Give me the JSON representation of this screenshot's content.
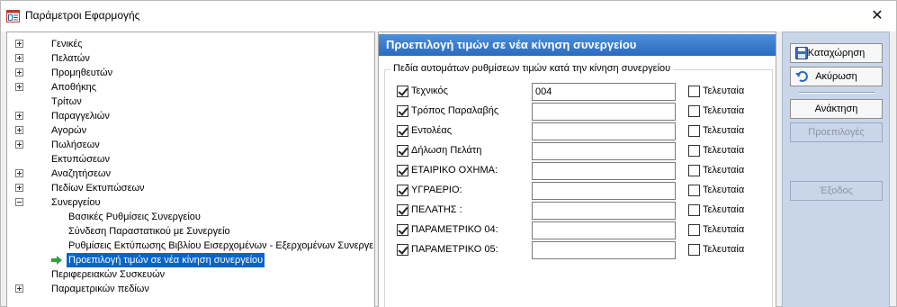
{
  "window": {
    "title": "Παράμετροι Εφαρμογής",
    "close_symbol": "✕"
  },
  "tree": {
    "items": [
      {
        "label": "Γενικές",
        "toggle": "plus"
      },
      {
        "label": "Πελατών",
        "toggle": "plus"
      },
      {
        "label": "Προμηθευτών",
        "toggle": "plus"
      },
      {
        "label": "Αποθήκης",
        "toggle": "plus"
      },
      {
        "label": "Τρίτων",
        "toggle": "none"
      },
      {
        "label": "Παραγγελιών",
        "toggle": "plus"
      },
      {
        "label": "Αγορών",
        "toggle": "plus"
      },
      {
        "label": "Πωλήσεων",
        "toggle": "plus"
      },
      {
        "label": "Εκτυπώσεων",
        "toggle": "none"
      },
      {
        "label": "Αναζητήσεων",
        "toggle": "plus"
      },
      {
        "label": "Πεδίων Εκτυπώσεων",
        "toggle": "plus"
      },
      {
        "label": "Συνεργείου",
        "toggle": "minus"
      },
      {
        "label": "Βασικές Ρυθμίσεις Συνεργείου",
        "toggle": "child"
      },
      {
        "label": "Σύνδεση Παραστατικού με Συνεργείο",
        "toggle": "child"
      },
      {
        "label": "Ρυθμίσεις Εκτύπωσης Βιβλίου Εισερχομένων - Εξερχομένων Συνεργείου",
        "toggle": "child"
      },
      {
        "label": "Προεπιλογή τιμών σε νέα κίνηση συνεργείου",
        "toggle": "selected"
      },
      {
        "label": "Περιφερειακών Συσκευών",
        "toggle": "none"
      },
      {
        "label": "Παραμετρικών πεδίων",
        "toggle": "plus"
      }
    ]
  },
  "content": {
    "header": "Προεπιλογή τιμών σε νέα κίνηση συνεργείου",
    "group_title": "Πεδία αυτομάτων ρυθμίσεων τιμών κατά την κίνηση συνεργείου",
    "last_label": "Τελευταία",
    "fields": [
      {
        "label": "Τεχνικός",
        "checked": true,
        "value": "004",
        "last_checked": false
      },
      {
        "label": "Τρόπος Παραλαβής",
        "checked": true,
        "value": "",
        "last_checked": false
      },
      {
        "label": "Εντολέας",
        "checked": true,
        "value": "",
        "last_checked": false
      },
      {
        "label": "Δήλωση Πελάτη",
        "checked": true,
        "value": "",
        "last_checked": false
      },
      {
        "label": "ΕΤΑΙΡΙΚΟ ΟΧΗΜΑ:",
        "checked": true,
        "value": "",
        "last_checked": false
      },
      {
        "label": "ΥΓΡΑΕΡΙΟ:",
        "checked": true,
        "value": "",
        "last_checked": false
      },
      {
        "label": "ΠΕΛΑΤΗΣ :",
        "checked": true,
        "value": "",
        "last_checked": false
      },
      {
        "label": "ΠΑΡΑΜΕΤΡΙΚΟ 04:",
        "checked": true,
        "value": "",
        "last_checked": false
      },
      {
        "label": "ΠΑΡΑΜΕΤΡΙΚΟ 05:",
        "checked": true,
        "value": "",
        "last_checked": false
      }
    ]
  },
  "buttons": {
    "save": "Καταχώρηση",
    "cancel": "Ακύρωση",
    "refresh": "Ανάκτηση",
    "defaults": "Προεπιλογές",
    "exit": "Έξοδος"
  },
  "colors": {
    "selection": "#0a64c8",
    "header_bar": "#2a6bbf",
    "button_panel": "#c9d6ea",
    "arrow": "#2ea043"
  }
}
